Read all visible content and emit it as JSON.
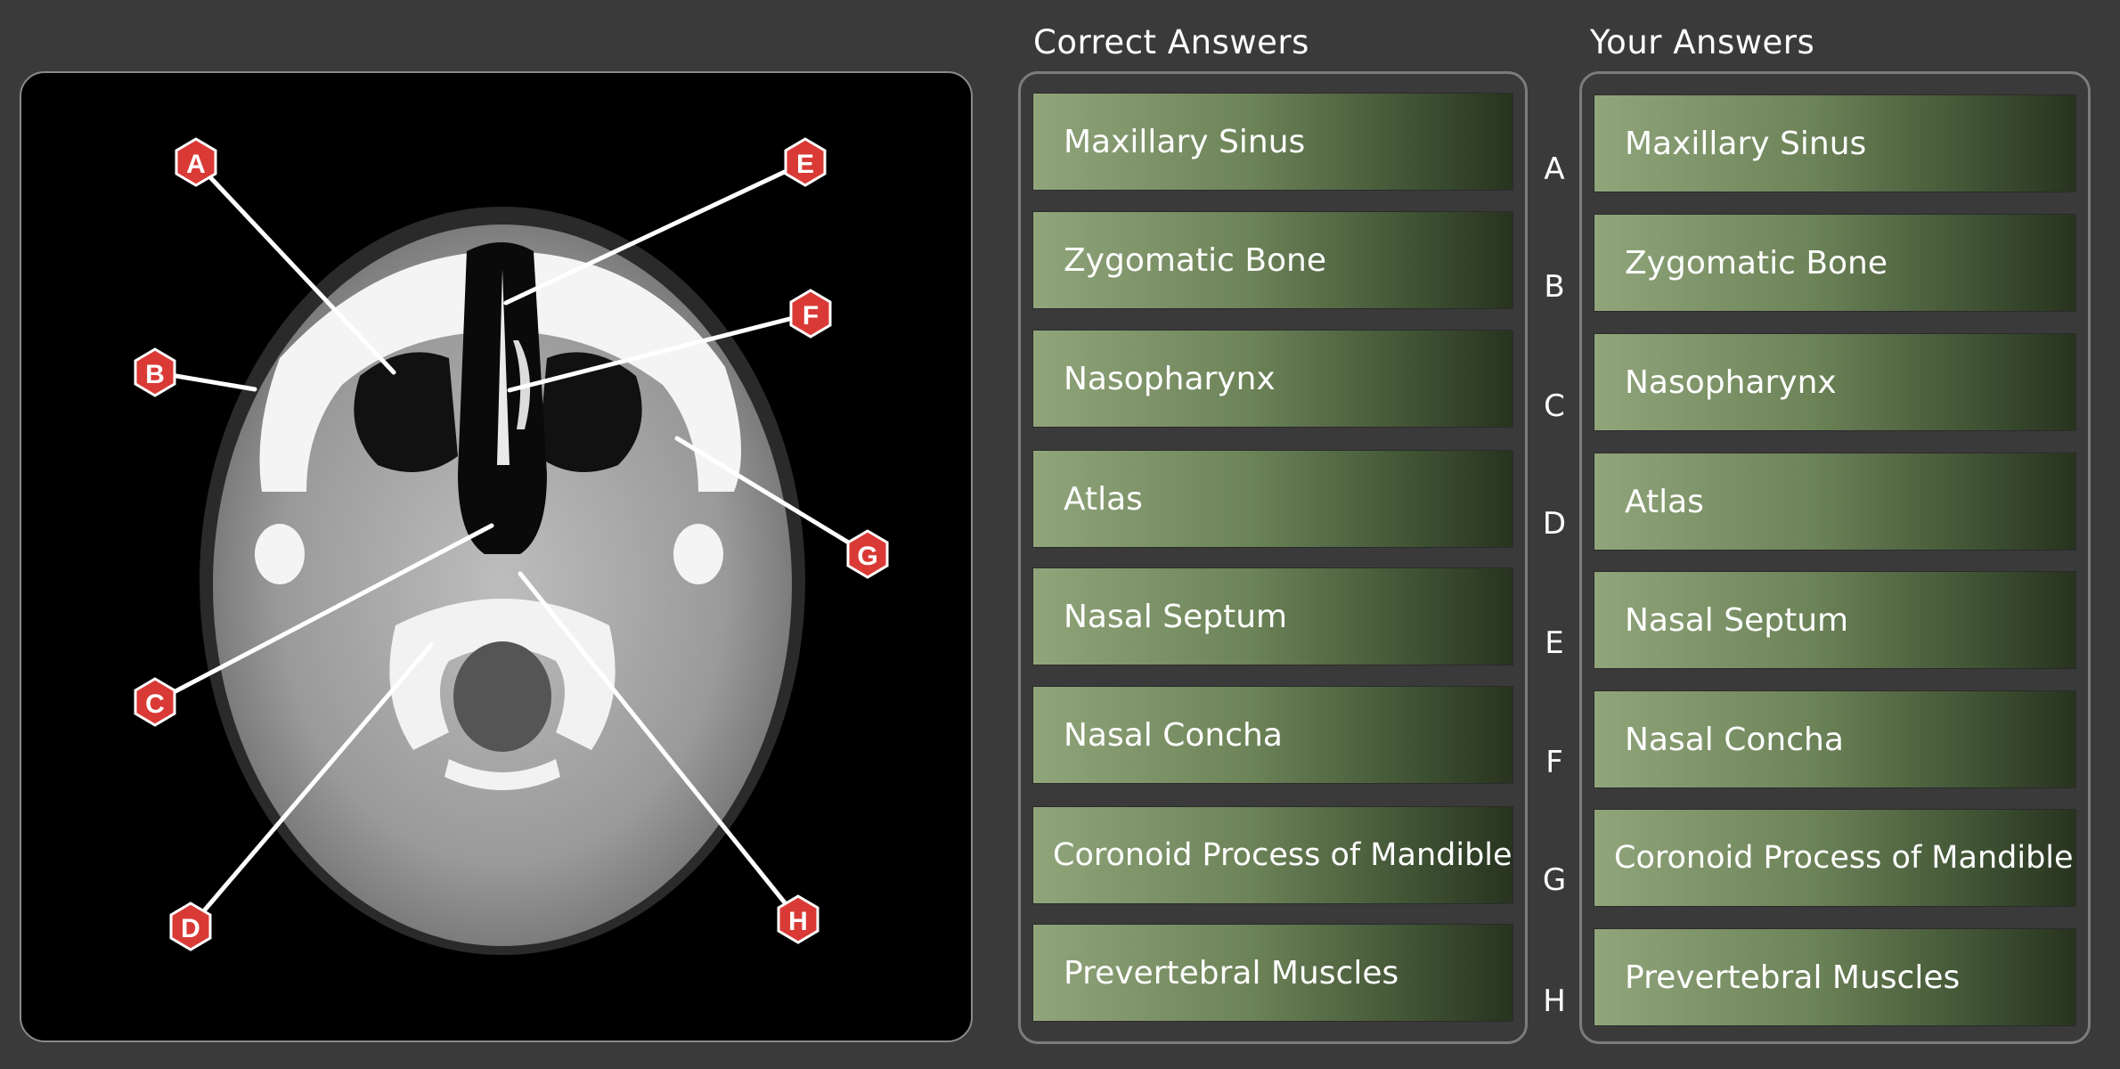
{
  "correct": {
    "title": "Correct Answers",
    "items": [
      "Maxillary Sinus",
      "Zygomatic Bone",
      "Nasopharynx",
      "Atlas",
      "Nasal Septum",
      "Nasal Concha",
      "Coronoid Process of Mandible",
      "Prevertebral Muscles"
    ]
  },
  "yours": {
    "title": "Your Answers",
    "items": [
      "Maxillary Sinus",
      "Zygomatic Bone",
      "Nasopharynx",
      "Atlas",
      "Nasal Septum",
      "Nasal Concha",
      "Coronoid Process of Mandible",
      "Prevertebral Muscles"
    ]
  },
  "letters": [
    "A",
    "B",
    "C",
    "D",
    "E",
    "F",
    "G",
    "H"
  ],
  "image": {
    "markers": [
      "A",
      "B",
      "C",
      "D",
      "E",
      "F",
      "G",
      "H"
    ]
  },
  "colors": {
    "marker": "#d93a36",
    "item_gradient_start": "#91a57b",
    "item_gradient_end": "#27331f",
    "background": "#3a3a3a"
  }
}
